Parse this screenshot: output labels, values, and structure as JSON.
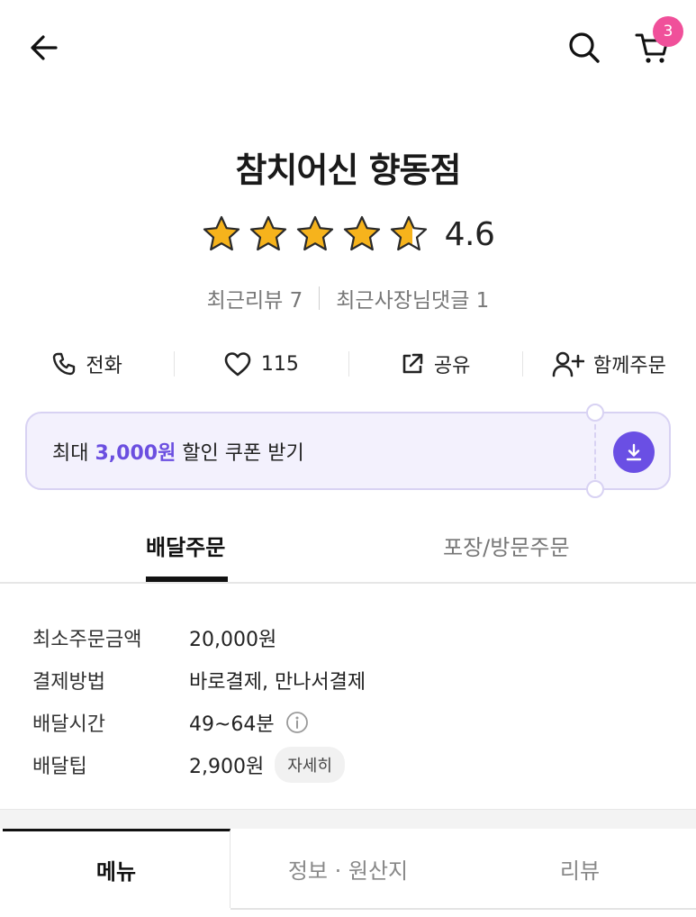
{
  "header": {
    "back_icon": "arrow-left-icon",
    "search_icon": "search-icon",
    "cart_icon": "cart-icon",
    "cart_count": "3",
    "badge_color": "#f0509a"
  },
  "store": {
    "name": "참치어신 향동점",
    "rating_value": 4.6,
    "rating_label": "4.6",
    "stars_max": 5,
    "recent_reviews": "최근리뷰 7",
    "recent_owner_replies": "최근사장님댓글 1"
  },
  "actions": [
    {
      "icon": "phone-icon",
      "label": "전화"
    },
    {
      "icon": "heart-icon",
      "label": "115"
    },
    {
      "icon": "share-icon",
      "label": "공유"
    },
    {
      "icon": "add-user-icon",
      "label": "함께주문"
    }
  ],
  "coupon": {
    "prefix": "최대 ",
    "amount": "3,000원",
    "suffix": " 할인 쿠폰 받기",
    "accent_color": "#6a4fe4",
    "download_icon": "download-icon"
  },
  "order_tabs": {
    "delivery": "배달주문",
    "pickup": "포장/방문주문",
    "active": "delivery"
  },
  "info": {
    "min_order_label": "최소주문금액",
    "min_order_value": "20,000원",
    "payment_label": "결제방법",
    "payment_value": "바로결제, 만나서결제",
    "time_label": "배달시간",
    "time_value": "49~64분",
    "time_icon": "info-icon",
    "tip_label": "배달팁",
    "tip_value": "2,900원",
    "tip_detail": "자세히"
  },
  "bottom_tabs": {
    "menu": "메뉴",
    "info": "정보 · 원산지",
    "review": "리뷰",
    "active": "menu"
  }
}
